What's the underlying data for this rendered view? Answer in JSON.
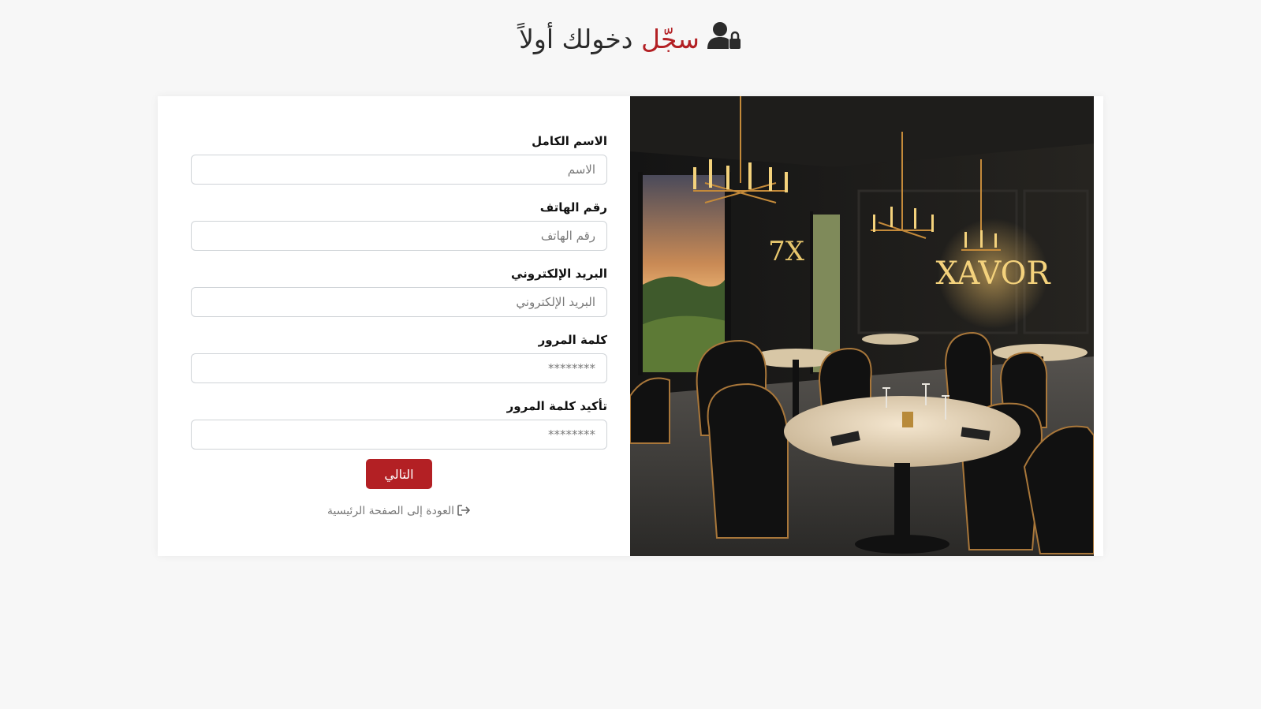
{
  "header": {
    "title_accent": "سجّل",
    "title_rest": " دخولك أولاً",
    "icon": "user-lock-icon"
  },
  "form": {
    "fields": [
      {
        "label": "الاسم الكامل",
        "placeholder": "الاسم",
        "value": ""
      },
      {
        "label": "رقم الهاتف",
        "placeholder": "رقم الهاتف",
        "value": ""
      },
      {
        "label": "البريد الإلكتروني",
        "placeholder": "البريد الإلكتروني",
        "value": ""
      },
      {
        "label": "كلمة المرور",
        "placeholder": "********",
        "value": ""
      },
      {
        "label": "تأكيد كلمة المرور",
        "placeholder": "********",
        "value": ""
      }
    ],
    "next_label": "التالي",
    "back_label": "العودة إلى الصفحة الرئيسية",
    "back_icon": "sign-out-icon"
  },
  "photo": {
    "sign_small": "7X",
    "sign_large": "XAVOR"
  },
  "colors": {
    "accent": "#b32024",
    "background": "#f7f7f7"
  }
}
